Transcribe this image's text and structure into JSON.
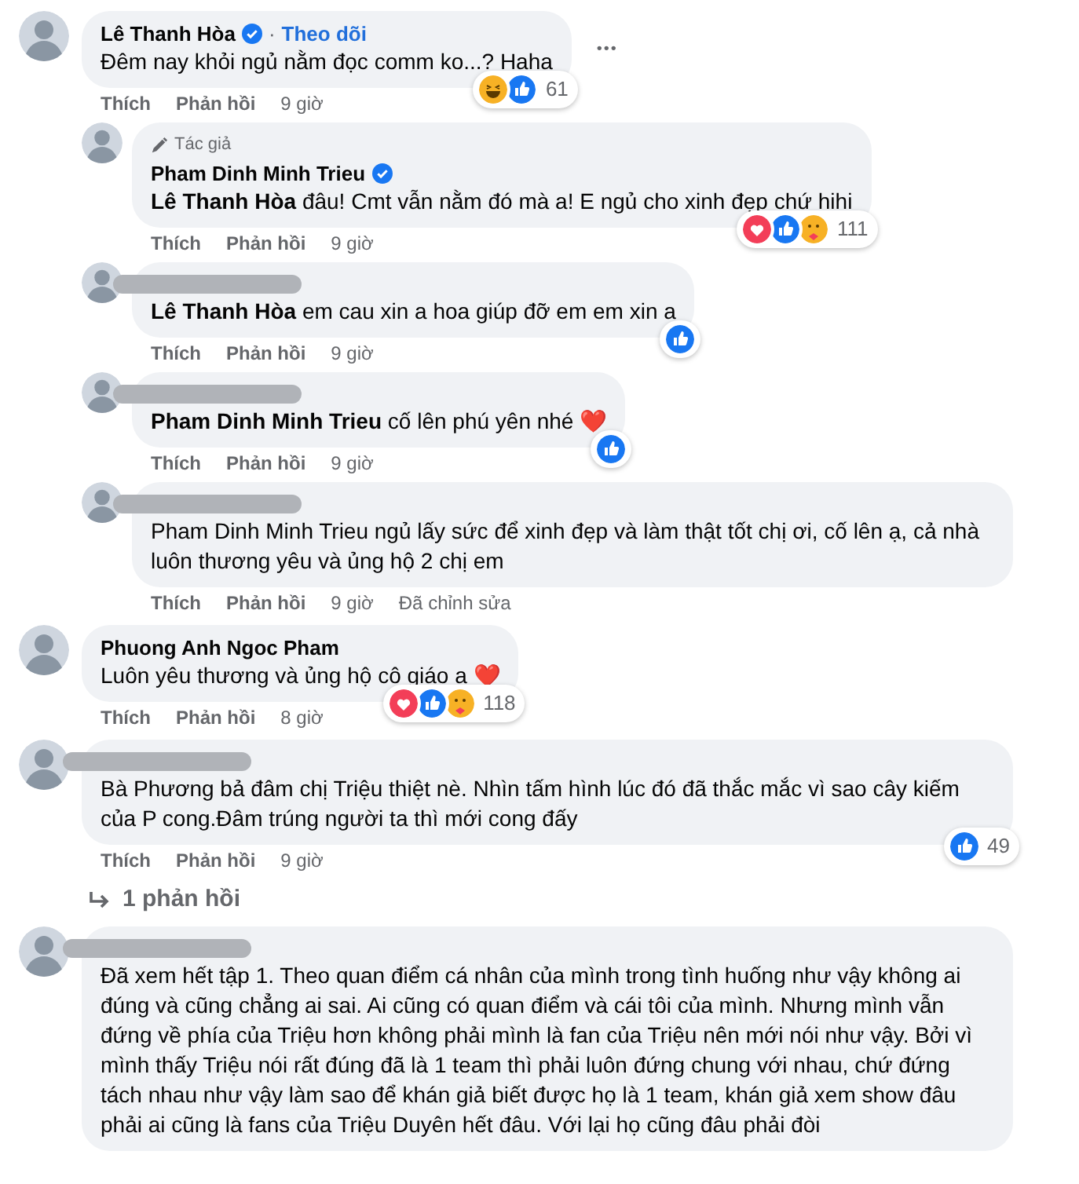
{
  "comments": [
    {
      "author": "Lê Thanh Hòa",
      "redacted": false,
      "verified": true,
      "separator": "·",
      "follow": "Theo dõi",
      "text": "Đêm nay khỏi ngủ nằm đọc comm ko...? Haha",
      "reactions": [
        {
          "kind": "haha"
        },
        {
          "kind": "like"
        }
      ],
      "reaction_count": "61",
      "menu": "•••",
      "actions": {
        "like": "Thích",
        "reply": "Phản hồi",
        "time": "9 giờ"
      },
      "children": [
        {
          "author": "Pham Dinh Minh Trieu",
          "redacted": false,
          "verified": true,
          "badge": "Tác giả",
          "text": "**Lê Thanh Hòa** đâu! Cmt vẫn nằm đó mà a! E ngủ cho xinh đẹp chứ hihi",
          "reactions": [
            {
              "kind": "love"
            },
            {
              "kind": "like"
            },
            {
              "kind": "care"
            }
          ],
          "reaction_count": "111",
          "actions": {
            "like": "Thích",
            "reply": "Phản hồi",
            "time": "9 giờ"
          }
        },
        {
          "redacted": true,
          "verified": false,
          "text": "**Lê Thanh Hòa** em cau xin a hoa giúp đỡ em em xin a",
          "reactions": [
            {
              "kind": "like"
            }
          ],
          "actions": {
            "like": "Thích",
            "reply": "Phản hồi",
            "time": "9 giờ"
          }
        },
        {
          "redacted": true,
          "verified": false,
          "text": "**Pham Dinh Minh Trieu** cố lên phú yên nhé ❤️",
          "reactions": [
            {
              "kind": "like"
            }
          ],
          "actions": {
            "like": "Thích",
            "reply": "Phản hồi",
            "time": "9 giờ"
          }
        },
        {
          "redacted": true,
          "verified": false,
          "text": "Pham Dinh Minh Trieu ngủ lấy sức để xinh đẹp và làm thật tốt chị ơi, cố lên ạ, cả nhà luôn thương yêu và ủng hộ 2 chị em",
          "actions": {
            "like": "Thích",
            "reply": "Phản hồi",
            "time": "9 giờ",
            "edited": "Đã chỉnh sửa"
          }
        }
      ]
    },
    {
      "author": "Phuong Anh Ngoc Pham",
      "redacted": false,
      "verified": false,
      "text": "Luôn yêu thương và ủng hộ cô giáo ạ ❤️",
      "reactions": [
        {
          "kind": "love"
        },
        {
          "kind": "like"
        },
        {
          "kind": "care"
        }
      ],
      "reaction_count": "118",
      "actions": {
        "like": "Thích",
        "reply": "Phản hồi",
        "time": "8 giờ"
      }
    },
    {
      "redacted": true,
      "verified": false,
      "text": "Bà Phương bả đâm chị Triệu thiệt nè. Nhìn tấm hình lúc đó đã thắc mắc vì sao cây kiếm của P cong.Đâm trúng người ta thì mới cong đấy",
      "reactions": [
        {
          "kind": "like"
        }
      ],
      "reaction_count": "49",
      "actions": {
        "like": "Thích",
        "reply": "Phản hồi",
        "time": "9 giờ"
      },
      "more_replies": "1 phản hồi"
    },
    {
      "redacted": true,
      "verified": false,
      "text": "Đã xem hết tập 1. Theo quan điểm cá nhân của mình trong tình huống như vậy không ai đúng và cũng chẳng ai sai. Ai cũng có quan điểm và cái tôi của mình. Nhưng mình vẫn đứng về phía của Triệu hơn không phải mình là fan của Triệu nên mới nói như vậy. Bởi vì mình thấy Triệu nói rất đúng đã là 1 team thì phải luôn đứng chung với nhau, chứ đứng tách nhau như vậy làm sao để khán giả biết được họ là 1 team, khán giả xem show đâu phải ai cũng là fans của Triệu Duyên hết đâu. Với lại họ cũng đâu phải đòi"
    }
  ]
}
